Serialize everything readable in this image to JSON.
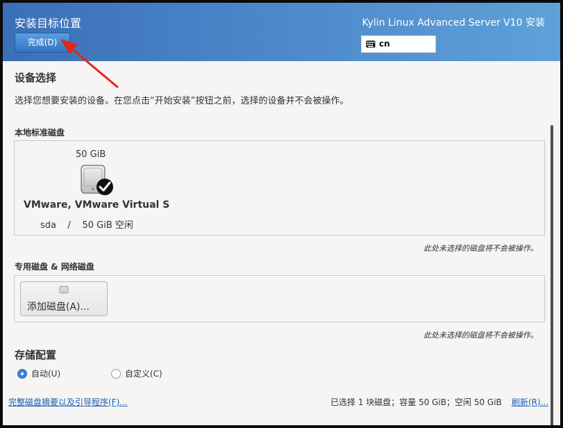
{
  "header": {
    "title": "安装目标位置",
    "done_label": "完成(D)",
    "product": "Kylin Linux Advanced Server V10 安装",
    "keyboard_layout": "cn"
  },
  "device_selection": {
    "heading": "设备选择",
    "description": "选择您想要安装的设备。在您点击“开始安装”按钮之前，选择的设备并不会被操作。"
  },
  "local_disks": {
    "heading": "本地标准磁盘",
    "disks": [
      {
        "size": "50 GiB",
        "name": "VMware, VMware Virtual S",
        "device": "sda",
        "separator": "/",
        "free": "50 GiB 空闲",
        "selected": true
      }
    ],
    "note": "此处未选择的磁盘将不会被操作。"
  },
  "network_disks": {
    "heading": "专用磁盘 & 网络磁盘",
    "add_label": "添加磁盘(A)...",
    "note": "此处未选择的磁盘将不会被操作。"
  },
  "storage": {
    "heading": "存储配置",
    "options": [
      {
        "label": "自动(U)",
        "selected": true
      },
      {
        "label": "自定义(C)",
        "selected": false
      }
    ]
  },
  "footer": {
    "summary_link": "完整磁盘摘要以及引导程序(F)...",
    "status": "已选择 1 块磁盘；容量 50 GiB；空闲 50 GiB",
    "refresh_link": "刷新(R)..."
  },
  "icons": {
    "keyboard": "keyboard-icon",
    "disk": "hard-disk-icon",
    "selected": "check-badge-icon",
    "annotation": "red-arrow-icon"
  },
  "colors": {
    "header_gradient_start": "#3b6fb6",
    "header_gradient_end": "#5fa1d8",
    "accent": "#3c82d1",
    "link": "#1a5fb4",
    "annotation_arrow": "#e3261c"
  }
}
